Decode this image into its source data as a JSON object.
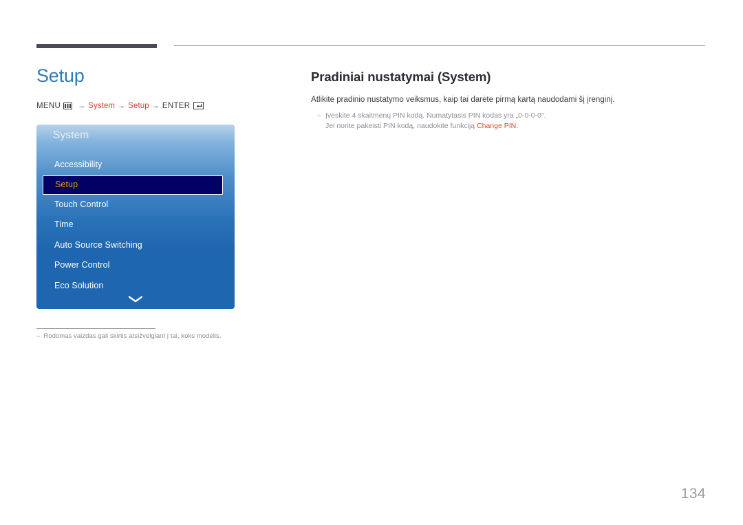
{
  "header": {
    "rule_dark_color": "#4a4a57",
    "rule_light_color": "#8b8b93"
  },
  "left": {
    "page_title": "Setup",
    "page_title_color": "#2f7cb9",
    "breadcrumb": {
      "menu_label": "MENU",
      "menu_icon": "menu-grid-icon",
      "arrow": "→",
      "step1": "System",
      "step2": "Setup",
      "enter_label": "ENTER",
      "enter_icon": "enter-return-icon",
      "accent_color": "#d9442b"
    },
    "osd": {
      "title": "System",
      "accent_selected_color": "#f0a000",
      "panel_color": "#1f66b0",
      "selected_bg_color": "#000065",
      "items": [
        {
          "label": "Accessibility",
          "selected": false
        },
        {
          "label": "Setup",
          "selected": true
        },
        {
          "label": "Touch Control",
          "selected": false
        },
        {
          "label": "Time",
          "selected": false
        },
        {
          "label": "Auto Source Switching",
          "selected": false
        },
        {
          "label": "Power Control",
          "selected": false
        },
        {
          "label": "Eco Solution",
          "selected": false
        }
      ],
      "scroll_icon": "chevron-down-icon"
    },
    "footnote": {
      "dash": "–",
      "text": "Rodomas vaizdas gali skirtis atsižvelgiant į tai, koks modelis."
    }
  },
  "right": {
    "title": "Pradiniai nustatymai (System)",
    "lead": "Atlikite pradinio nustatymo veiksmus, kaip tai darėte pirmą kartą naudodami šį įrenginį.",
    "note": {
      "dash": "–",
      "line1": "Įveskite 4 skaitmenų PIN kodą. Numatytasis PIN kodas yra „0-0-0-0“.",
      "line2_prefix": "Jei norite pakeisti PIN kodą, naudokite funkciją ",
      "line2_accent": "Change PIN",
      "line2_suffix": ".",
      "accent_color": "#e24b2a"
    }
  },
  "footer": {
    "page_number": "134"
  }
}
